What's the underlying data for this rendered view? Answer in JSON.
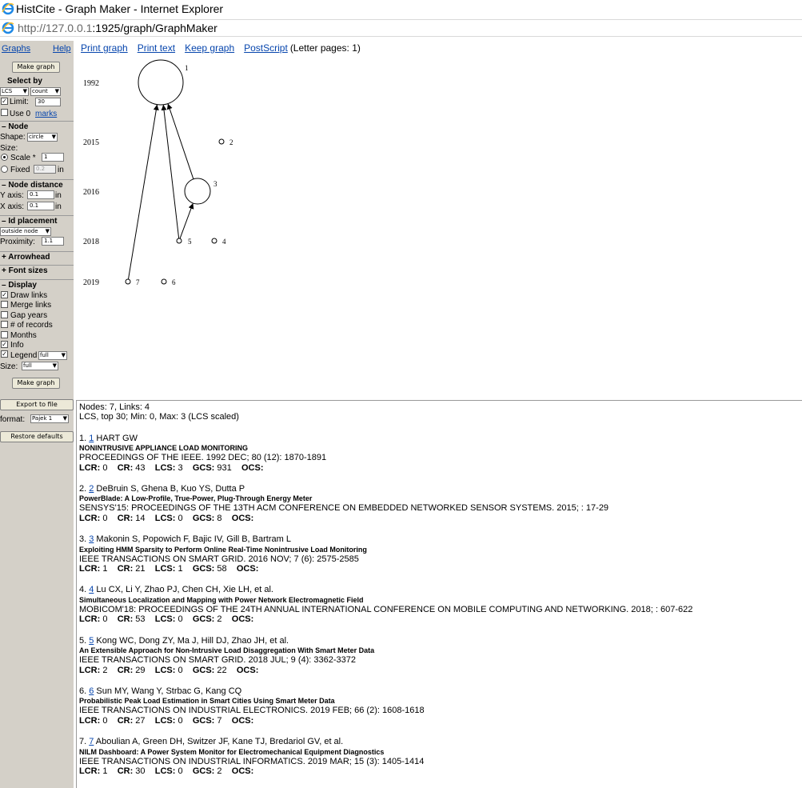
{
  "window": {
    "title": "HistCite - Graph Maker - Internet Explorer",
    "url_host": "http://127.0.0.1",
    "url_rest": ":1925/graph/GraphMaker"
  },
  "sidebar": {
    "graphs_label": "Graphs",
    "help_label": "Help",
    "make_graph_label": "Make graph",
    "select_by_label": "Select by",
    "select_field": "LCS",
    "select_mode": "count",
    "limit_label": "Limit:",
    "limit_value": "30",
    "use0_label": "Use 0",
    "marks_label": "marks",
    "node_section": "– Node",
    "shape_label": "Shape:",
    "shape_value": "circle",
    "size_label": "Size:",
    "scale_label": "Scale *",
    "scale_value": "1",
    "fixed_label": "Fixed",
    "fixed_value": "0.2",
    "fixed_unit": "in",
    "node_distance_section": "– Node distance",
    "yaxis_label": "Y axis:",
    "yaxis_value": "0.1",
    "xaxis_label": "X axis:",
    "xaxis_value": "0.1",
    "unit_in": "in",
    "id_placement_section": "– Id placement",
    "id_placement_value": "outside node",
    "proximity_label": "Proximity:",
    "proximity_value": "1.1",
    "arrowhead_section": "+ Arrowhead",
    "font_sizes_section": "+ Font sizes",
    "display_section": "– Display",
    "display_options": [
      {
        "label": "Draw links",
        "checked": true
      },
      {
        "label": "Merge links",
        "checked": false
      },
      {
        "label": "Gap years",
        "checked": false
      },
      {
        "label": "# of records",
        "checked": false
      },
      {
        "label": "Months",
        "checked": false
      },
      {
        "label": "Info",
        "checked": true
      }
    ],
    "legend_label": "Legend",
    "legend_value": "full",
    "size2_label": "Size:",
    "size2_value": "full",
    "make_graph_label2": "Make graph",
    "export_label": "Export to file",
    "format_label": "format:",
    "format_value": "Pajek 1",
    "restore_label": "Restore defaults"
  },
  "toolbar": {
    "print_graph": "Print graph",
    "print_text": "Print text",
    "keep_graph": "Keep graph",
    "postscript": "PostScript",
    "pages": "(Letter pages: 1)"
  },
  "graph": {
    "years": [
      "1992",
      "2015",
      "2016",
      "2018",
      "2019"
    ],
    "nodes": [
      {
        "id": "1",
        "year": "1992",
        "lcs": 3
      },
      {
        "id": "2",
        "year": "2015",
        "lcs": 0
      },
      {
        "id": "3",
        "year": "2016",
        "lcs": 1
      },
      {
        "id": "4",
        "year": "2018",
        "lcs": 0
      },
      {
        "id": "5",
        "year": "2018",
        "lcs": 0
      },
      {
        "id": "6",
        "year": "2019",
        "lcs": 0
      },
      {
        "id": "7",
        "year": "2019",
        "lcs": 0
      }
    ],
    "links": [
      {
        "from": "7",
        "to": "1"
      },
      {
        "from": "5",
        "to": "1"
      },
      {
        "from": "3",
        "to": "1"
      },
      {
        "from": "5",
        "to": "3"
      }
    ]
  },
  "info": {
    "summary1": "Nodes: 7, Links: 4",
    "summary2": "LCS, top 30; Min: 0, Max: 3 (LCS scaled)",
    "records": [
      {
        "num": "1.",
        "link": "1",
        "authors": "HART GW",
        "title": "NONINTRUSIVE APPLIANCE LOAD MONITORING",
        "source": "PROCEEDINGS OF THE IEEE. 1992 DEC; 80 (12): 1870-1891",
        "lcr": "0",
        "cr": "43",
        "lcs": "3",
        "gcs": "931",
        "ocs": ""
      },
      {
        "num": "2.",
        "link": "2",
        "authors": "DeBruin S, Ghena B, Kuo YS, Dutta P",
        "title": "PowerBlade: A Low-Profile, True-Power, Plug-Through Energy Meter",
        "source": "SENSYS'15: PROCEEDINGS OF THE 13TH ACM CONFERENCE ON EMBEDDED NETWORKED SENSOR SYSTEMS. 2015; : 17-29",
        "lcr": "0",
        "cr": "14",
        "lcs": "0",
        "gcs": "8",
        "ocs": ""
      },
      {
        "num": "3.",
        "link": "3",
        "authors": "Makonin S, Popowich F, Bajic IV, Gill B, Bartram L",
        "title": "Exploiting HMM Sparsity to Perform Online Real-Time Nonintrusive Load Monitoring",
        "source": "IEEE TRANSACTIONS ON SMART GRID. 2016 NOV; 7 (6): 2575-2585",
        "lcr": "1",
        "cr": "21",
        "lcs": "1",
        "gcs": "58",
        "ocs": ""
      },
      {
        "num": "4.",
        "link": "4",
        "authors": "Lu CX, Li Y, Zhao PJ, Chen CH, Xie LH, et al.",
        "title": "Simultaneous Localization and Mapping with Power Network Electromagnetic Field",
        "source": "MOBICOM'18: PROCEEDINGS OF THE 24TH ANNUAL INTERNATIONAL CONFERENCE ON MOBILE COMPUTING AND NETWORKING. 2018; : 607-622",
        "lcr": "0",
        "cr": "53",
        "lcs": "0",
        "gcs": "2",
        "ocs": ""
      },
      {
        "num": "5.",
        "link": "5",
        "authors": "Kong WC, Dong ZY, Ma J, Hill DJ, Zhao JH, et al.",
        "title": "An Extensible Approach for Non-Intrusive Load Disaggregation With Smart Meter Data",
        "source": "IEEE TRANSACTIONS ON SMART GRID. 2018 JUL; 9 (4): 3362-3372",
        "lcr": "2",
        "cr": "29",
        "lcs": "0",
        "gcs": "22",
        "ocs": ""
      },
      {
        "num": "6.",
        "link": "6",
        "authors": "Sun MY, Wang Y, Strbac G, Kang CQ",
        "title": "Probabilistic Peak Load Estimation in Smart Cities Using Smart Meter Data",
        "source": "IEEE TRANSACTIONS ON INDUSTRIAL ELECTRONICS. 2019 FEB; 66 (2): 1608-1618",
        "lcr": "0",
        "cr": "27",
        "lcs": "0",
        "gcs": "7",
        "ocs": ""
      },
      {
        "num": "7.",
        "link": "7",
        "authors": "Aboulian A, Green DH, Switzer JF, Kane TJ, Bredariol GV, et al.",
        "title": "NILM Dashboard: A Power System Monitor for Electromechanical Equipment Diagnostics",
        "source": "IEEE TRANSACTIONS ON INDUSTRIAL INFORMATICS. 2019 MAR; 15 (3): 1405-1414",
        "lcr": "1",
        "cr": "30",
        "lcs": "0",
        "gcs": "2",
        "ocs": ""
      }
    ],
    "metric_labels": {
      "lcr": "LCR:",
      "cr": "CR:",
      "lcs": "LCS:",
      "gcs": "GCS:",
      "ocs": "OCS:"
    }
  }
}
